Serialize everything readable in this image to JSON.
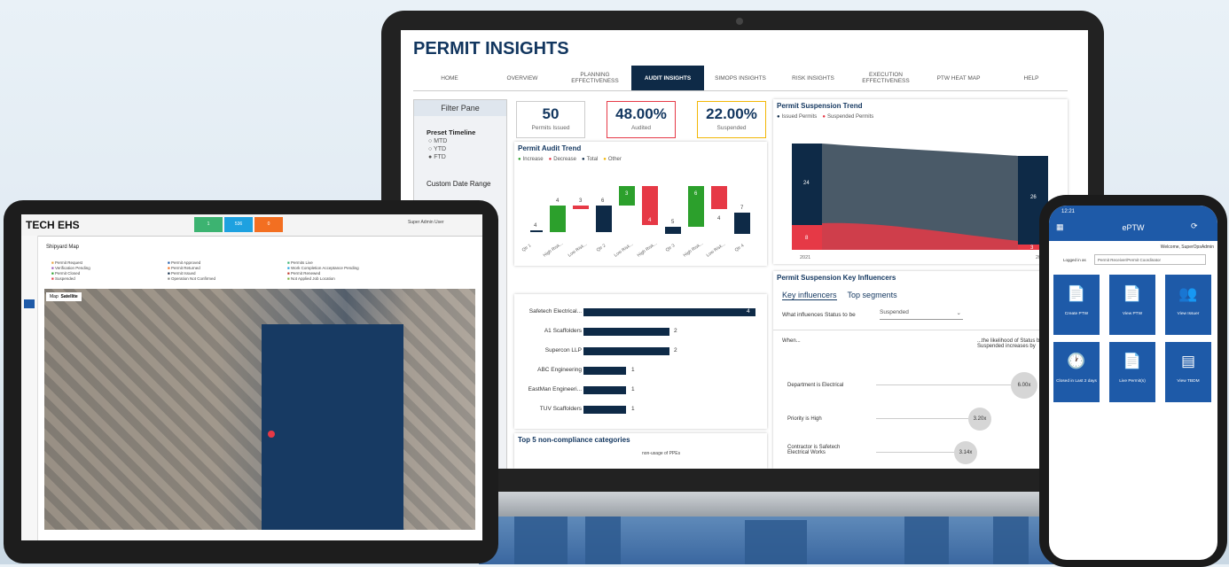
{
  "laptop": {
    "title": "PERMIT INSIGHTS",
    "nav": [
      "HOME",
      "OVERVIEW",
      "PLANNING EFFECTIVENESS",
      "AUDIT INSIGHTS",
      "SIMOPS INSIGHTS",
      "RISK INSIGHTS",
      "EXECUTION EFFECTIVENESS",
      "PTW HEAT MAP",
      "HELP"
    ],
    "active_tab": "AUDIT INSIGHTS",
    "filter": {
      "title": "Filter Pane",
      "preset": "Preset Timeline",
      "options": [
        "MTD",
        "YTD",
        "FTD"
      ],
      "selected": "FTD",
      "custom": "Custom Date Range"
    },
    "kpis": [
      {
        "value": "50",
        "label": "Permits Issued"
      },
      {
        "value": "48.00%",
        "label": "Audited"
      },
      {
        "value": "22.00%",
        "label": "Suspended"
      }
    ],
    "audit_trend": {
      "title": "Permit Audit Trend",
      "legend": [
        "Increase",
        "Decrease",
        "Total",
        "Other"
      ],
      "bar_values": [
        "4",
        "4",
        "3",
        "6",
        "3",
        "4",
        "5",
        "6",
        "4",
        "7"
      ],
      "x_labels": [
        "Qtr 1",
        "High Risk...",
        "Low Risk...",
        "Qtr 2",
        "Low Risk...",
        "High Risk...",
        "Qtr 3",
        "High Risk...",
        "Low Risk...",
        "Qtr 4"
      ]
    },
    "suspension_trend": {
      "title": "Permit Suspension Trend",
      "legend": [
        "Issued Permits",
        "Suspended Permits"
      ],
      "start_issued": "24",
      "start_susp": "8",
      "end_issued": "26",
      "end_susp": "3",
      "x_start": "2021",
      "x_end": "2022"
    },
    "contractors": [
      {
        "name": "Safetech Electrical...",
        "count": "4"
      },
      {
        "name": "A1 Scaffolders",
        "count": "2"
      },
      {
        "name": "Supercon LLP",
        "count": "2"
      },
      {
        "name": "ABC Engineering",
        "count": "1"
      },
      {
        "name": "EastMan Engineeri...",
        "count": "1"
      },
      {
        "name": "TUV Scaffolders",
        "count": "1"
      }
    ],
    "noncompliance": {
      "title": "Top 5 non-compliance categories",
      "item": "non-usage of PPEs"
    },
    "key_influencers": {
      "title": "Permit Suspension Key Influencers",
      "tabs": [
        "Key influencers",
        "Top segments"
      ],
      "question": "What influences Status to be",
      "value": "Suspended",
      "when": "When...",
      "likelihood": "...the likelihood of Status being Suspended increases by",
      "rows": [
        {
          "label": "Department is Electrical",
          "factor": "6.00x"
        },
        {
          "label": "Priority is High",
          "factor": "3.20x"
        },
        {
          "label": "Contractor is Safetech Electrical Works",
          "factor": "3.14x"
        }
      ]
    }
  },
  "tablet": {
    "logo": "TECH EHS",
    "kpis": [
      {
        "value": "1",
        "color": "#3cb371"
      },
      {
        "value": "536",
        "color": "#1ea1e0"
      },
      {
        "value": "0",
        "color": "#f36f21"
      }
    ],
    "user": "Super Admin User",
    "subtitle": "Shipyard Map",
    "map_tabs": [
      "Map",
      "Satellite"
    ],
    "checks": [
      "Permit Request",
      "Verification Pending",
      "Permit Closed",
      "Suspended",
      "Permit Approved",
      "Permit Returned",
      "Permit Issued",
      "Operation Not Confirmed",
      "Permits Live",
      "Work Completion Acceptance Pending",
      "Permit Renewed",
      "Not Applied Job Location"
    ]
  },
  "phone": {
    "time": "12:21",
    "title": "ePTW",
    "welcome": "Welcome, SuperOpsAdmin",
    "logged": "Logged in as",
    "role": "Permit Receiver/Permit Coordinator",
    "tiles": [
      {
        "label": "Create PTW",
        "icon": "📄"
      },
      {
        "label": "View PTW",
        "icon": "📄"
      },
      {
        "label": "View Issuer",
        "icon": "👥"
      },
      {
        "label": "Closed in Last 2 days",
        "icon": "🕐"
      },
      {
        "label": "Live Permit(s)",
        "icon": "📄"
      },
      {
        "label": "View TBDM",
        "icon": "▤"
      }
    ]
  },
  "colors": {
    "navy": "#0e2a47",
    "red": "#e63946",
    "green": "#2ca02c",
    "blue": "#1e5aa8",
    "yellow": "#f2b705"
  }
}
